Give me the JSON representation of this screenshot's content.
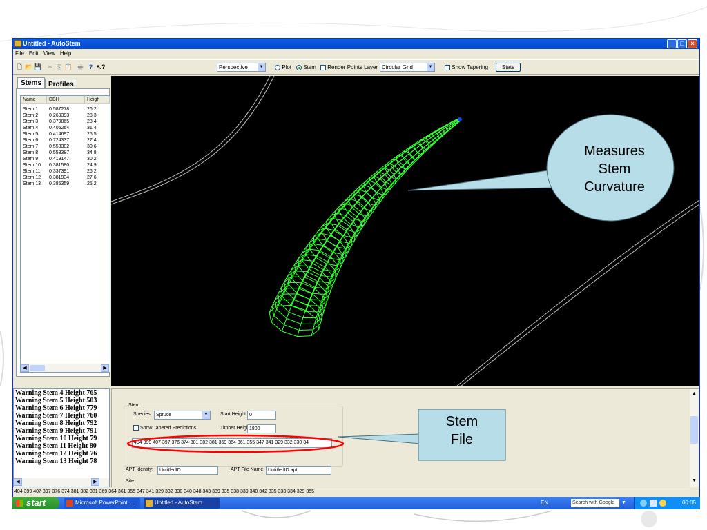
{
  "window": {
    "title": "Untitled - AutoStem",
    "minimize": "_",
    "maximize": "□",
    "close": "×"
  },
  "menu": [
    "File",
    "Edit",
    "View",
    "Help"
  ],
  "toolbar": {
    "icons": [
      "new-file",
      "open",
      "save",
      "cut",
      "copy",
      "paste",
      "print",
      "help",
      "context-help"
    ],
    "icon_glyphs": [
      "🗋",
      "📂",
      "💾",
      "✂",
      "⎘",
      "📋",
      "🖶",
      "?",
      "↖?"
    ],
    "view_mode": "Perspective",
    "plot_label": "Plot",
    "stem_label": "Stem",
    "render_points_label": "Render Points Layer",
    "grid_mode": "Circular Grid",
    "show_tapering_label": "Show Tapering",
    "stats_label": "Stats",
    "selected_radio": "Stem"
  },
  "tabs": [
    "Stems",
    "Profiles"
  ],
  "stems_table": {
    "headers": [
      "Name",
      "DBH",
      "Heigh"
    ],
    "rows": [
      [
        "Stem 1",
        "0.587278",
        "26.2"
      ],
      [
        "Stem 2",
        "0.269393",
        "28.3"
      ],
      [
        "Stem 3",
        "0.379865",
        "28.4"
      ],
      [
        "Stem 4",
        "0.405264",
        "31.4"
      ],
      [
        "Stem 5",
        "0.414697",
        "25.5"
      ],
      [
        "Stem 6",
        "0.724337",
        "27.4"
      ],
      [
        "Stem 7",
        "0.553302",
        "30.6"
      ],
      [
        "Stem 8",
        "0.553387",
        "34.8"
      ],
      [
        "Stem 9",
        "0.419147",
        "30.2"
      ],
      [
        "Stem 10",
        "0.381580",
        "24.9"
      ],
      [
        "Stem 11",
        "0.337391",
        "26.2"
      ],
      [
        "Stem 12",
        "0.381934",
        "27.6"
      ],
      [
        "Stem 13",
        "0.385359",
        "25.2"
      ]
    ]
  },
  "warnings": [
    "Warning Stem 4 Height 765",
    "Warning Stem 5 Height 503",
    "Warning Stem 6 Height 779",
    "Warning Stem 7 Height 760",
    "Warning Stem 8 Height 792",
    "Warning Stem 9 Height 791",
    "Warning Stem 10 Height 79",
    "Warning Stem 11 Height 80",
    "Warning Stem 12 Height 76",
    "Warning Stem 13 Height 78"
  ],
  "stem_group": {
    "title": "Stem",
    "species_label": "Species:",
    "species_value": "Spruce",
    "start_height_label": "Start Height:",
    "start_height_value": "0",
    "show_tapered_label": "Show Tapered Predictions",
    "timber_height_label": "Timber Height:",
    "timber_height_value": "1800",
    "stem_file_values": "404 399 407 397 376 374 381 382 381 369 364 361 355 347 341 329 332 330 34"
  },
  "apt": {
    "identity_label": "APT Identity:",
    "identity_value": "UntitledID",
    "file_name_label": "APT File Name:",
    "file_name_value": "UntitledID.apt",
    "site_label": "Site"
  },
  "status_text": "404 399 407 397 376 374 381 382 381 369 364 361 355 347 341 329 332 330 340 348 343 339 335 338 339 340 342 335 333 334 329 355",
  "taskbar": {
    "start_label": "start",
    "tasks": [
      "Microsoft PowerPoint ...",
      "Untitled - AutoStem"
    ],
    "language": "EN",
    "search_placeholder": "Search with Google",
    "clock": "00:05"
  },
  "callouts": {
    "curvature": [
      "Measures",
      "Stem",
      "Curvature"
    ],
    "stem_file": [
      "Stem",
      "File"
    ]
  },
  "colors": {
    "stem_mesh": "#33ff33",
    "callout_fill": "#b7dde8",
    "highlight_ring": "#ff0000",
    "titlebar": "#0a5fe6"
  }
}
